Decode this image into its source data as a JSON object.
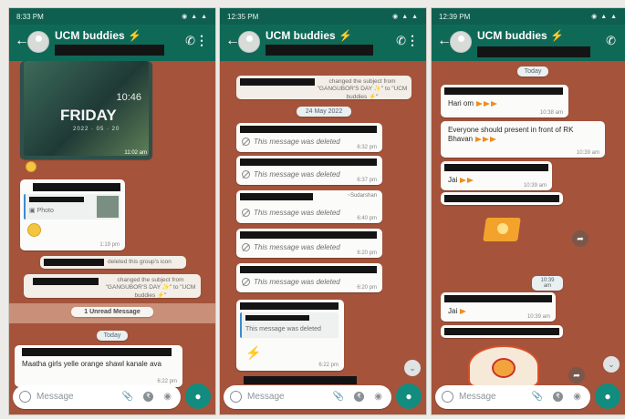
{
  "chat": {
    "title": "UCM buddies ⚡",
    "input_placeholder": "Message"
  },
  "screens": [
    {
      "status_time": "8:33 PM",
      "status_icons": "◉ ▲ ▲",
      "wallpaper_day": "FRIDAY",
      "wallpaper_clock": "10:46",
      "wallpaper_date": "2022 · 05 · 20",
      "image_time": "11:02 am",
      "photo_label": "Photo",
      "photo_time": "1:19 pm",
      "sys_icon_deleted": "deleted this group's icon",
      "sys_subject_changed": "changed the subject from \"GANGUBOR'S DAY ✨\" to \"UCM buddies ⚡\"",
      "unread": "1 Unread Message",
      "date_pill": "Today",
      "last_msg": "Maatha girls yelle orange shawl kanale ava",
      "last_time": "6:22 pm"
    },
    {
      "status_time": "12:35 PM",
      "sys_subject_changed": "changed the subject from \"GANGUBOR'S DAY ✨\" to \"UCM buddies ⚡\"",
      "date_pill": "24 May 2022",
      "deleted_text": "This message was deleted",
      "deleted_times": [
        "6:32 pm",
        "6:37 pm",
        "6:40 pm",
        "6:20 pm",
        "6:20 pm"
      ],
      "sender": "~Sudarshan",
      "quoted_deleted": "This message was deleted",
      "reply_time": "6:22 pm"
    },
    {
      "status_time": "12:39 PM",
      "date_pill": "Today",
      "msg1": "Hari om",
      "msg1_time": "10:38 am",
      "msg2": "Everyone should present in front of RK Bhavan",
      "msg2_time": "10:39 am",
      "msg3": "Jai",
      "msg3_time": "10:39 am",
      "mid_time": "10:39 am",
      "msg4": "Jai",
      "msg4_time": "10:39 am"
    }
  ]
}
